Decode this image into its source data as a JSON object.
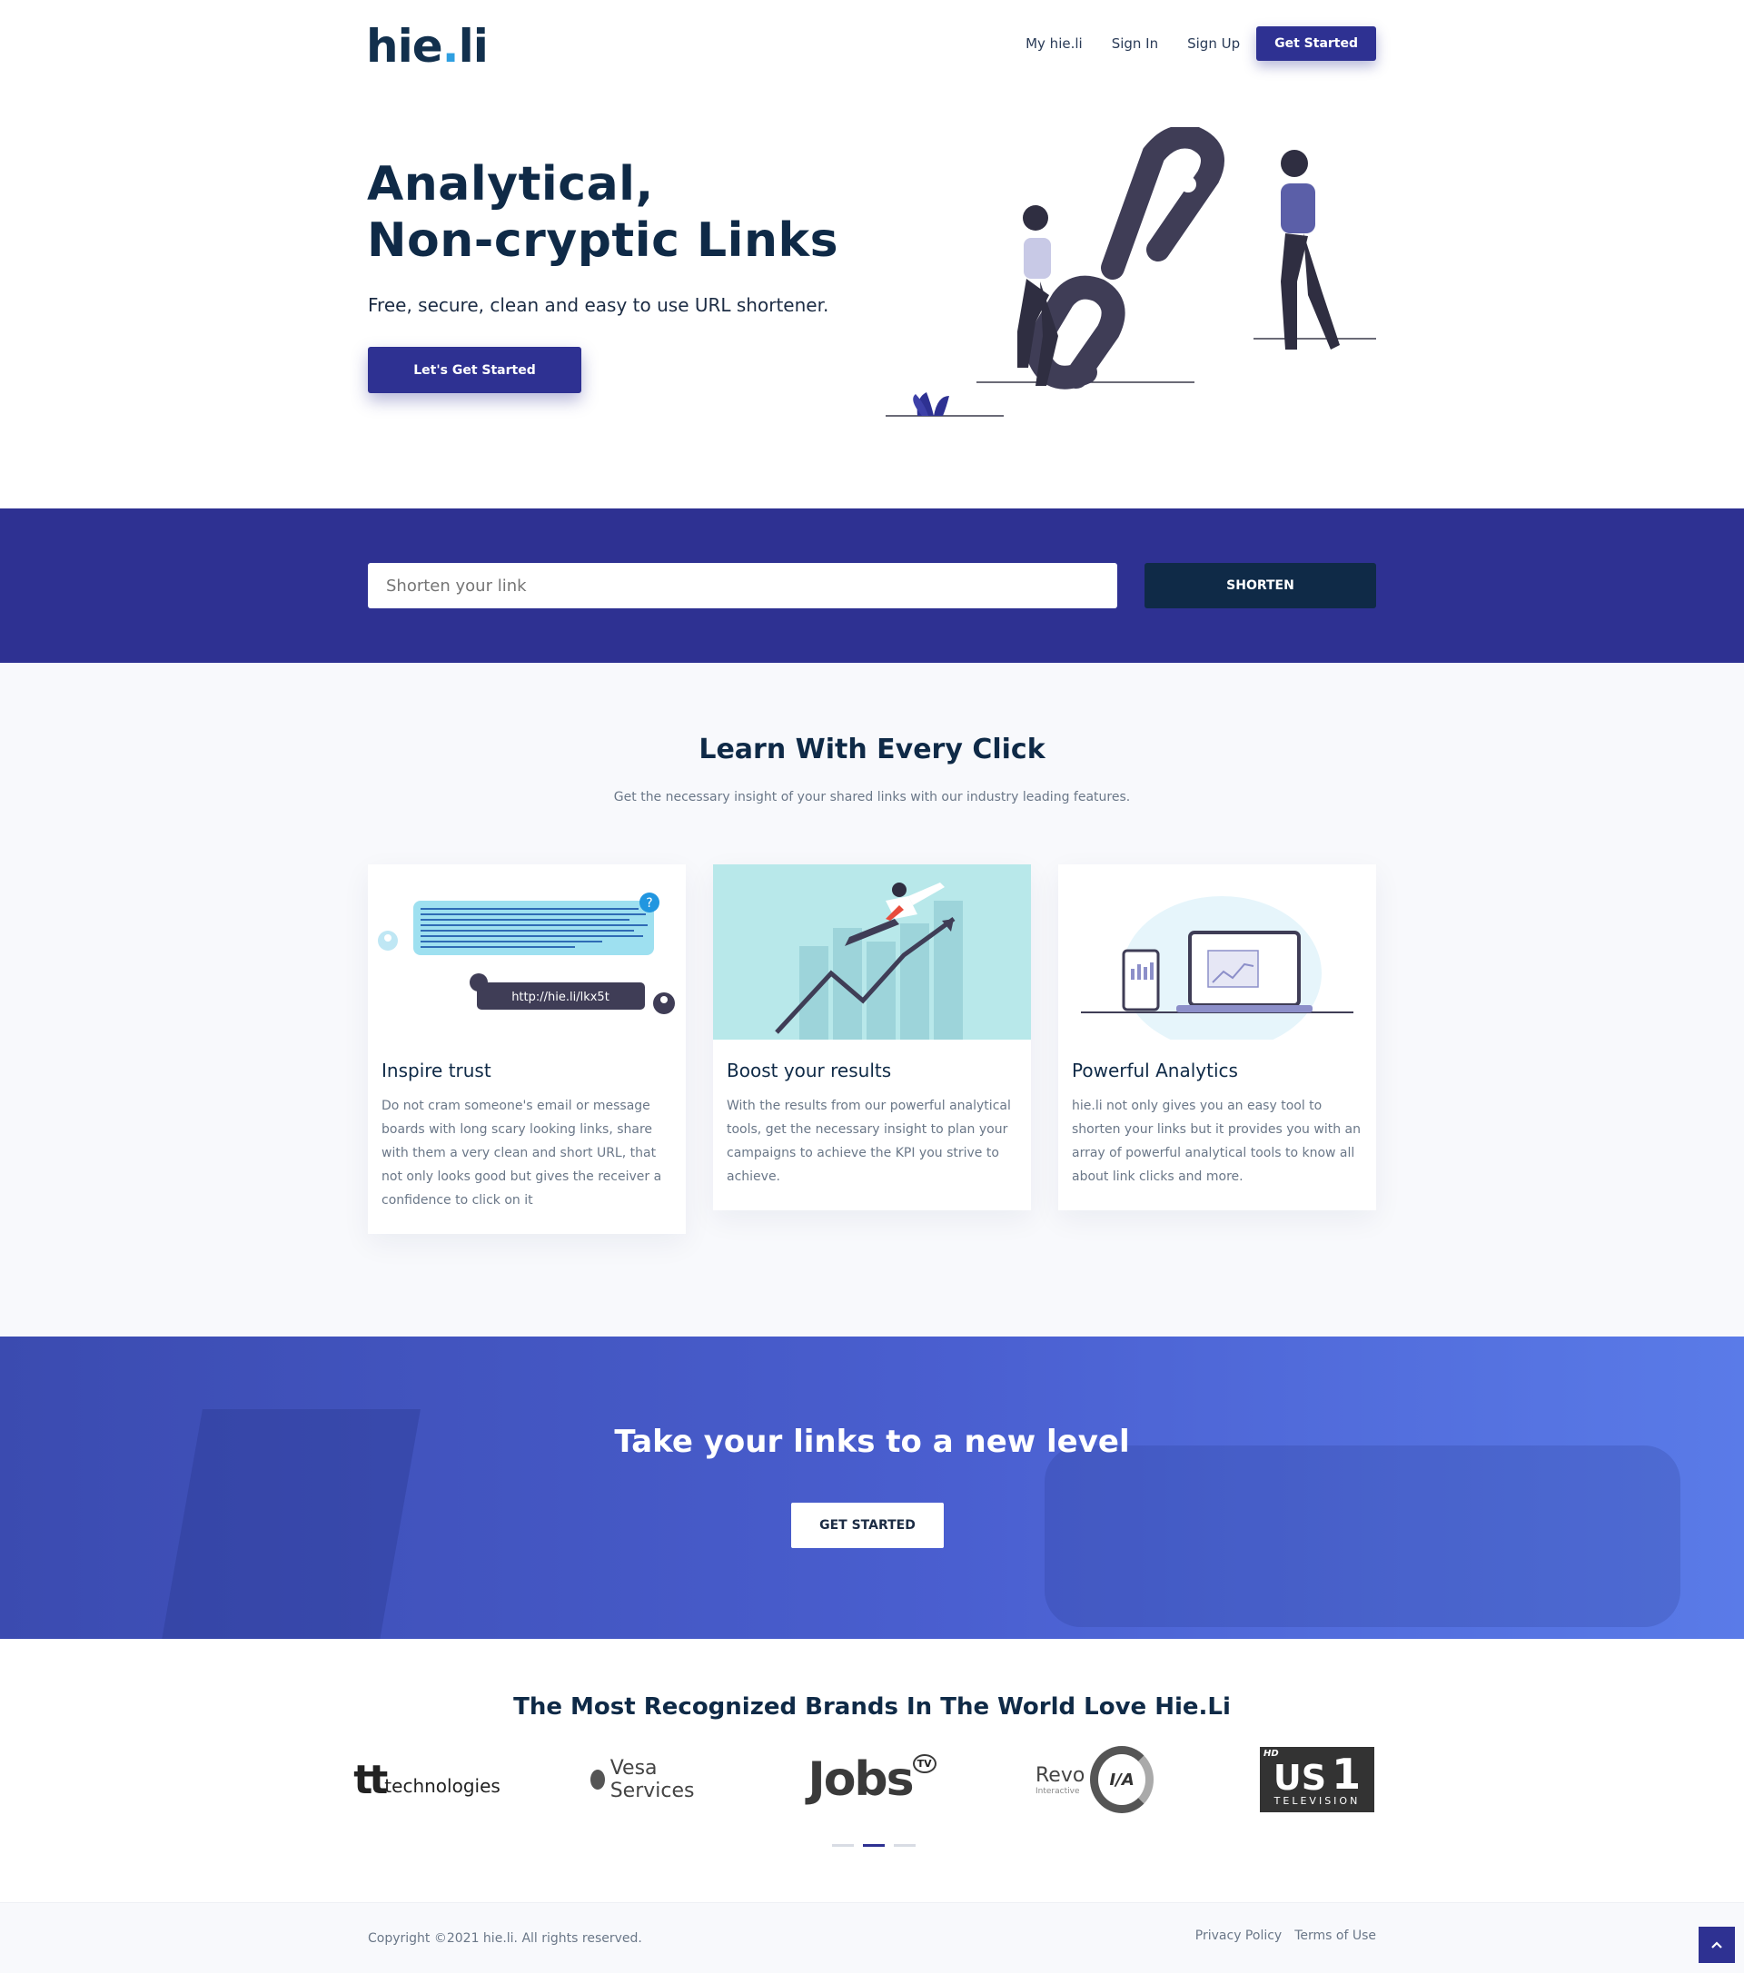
{
  "header": {
    "logo_left": "hie",
    "logo_dot": ".",
    "logo_right": "li",
    "nav": [
      "My hie.li",
      "Sign In",
      "Sign Up"
    ],
    "cta_label": "Get Started"
  },
  "hero": {
    "title_line1": "Analytical,",
    "title_line2": "Non-cryptic Links",
    "subtitle": "Free, secure, clean and easy to use URL shortener.",
    "button_label": "Let's Get Started"
  },
  "shortener": {
    "placeholder": "Shorten your link",
    "button_label": "SHORTEN"
  },
  "features": {
    "title": "Learn With Every Click",
    "subtitle": "Get the necessary insight of your shared links with our industry leading features.",
    "cards": [
      {
        "title": "Inspire trust",
        "text": "Do not cram someone's email or message boards with long scary looking links, share with them a very clean and short URL, that not only looks good but gives the receiver a confidence to click on it",
        "image_short_url": "http://hie.li/lkx5t"
      },
      {
        "title": "Boost your results",
        "text": "With the results from our powerful analytical tools, get the necessary insight to plan your campaigns to achieve the KPI you strive to achieve."
      },
      {
        "title": "Powerful Analytics",
        "text": "hie.li not only gives you an easy tool to shorten your links but it provides you with an array of powerful analytical tools to know all about link clicks and more."
      }
    ]
  },
  "cta": {
    "title": "Take your links to a new level",
    "button_label": "GET STARTED"
  },
  "brands": {
    "title": "The Most Recognized Brands In The World Love Hie.Li",
    "logos": [
      {
        "name": "tt technologies",
        "mark": "tt",
        "text": "technologies"
      },
      {
        "name": "Vesa Services",
        "text": "Vesa Services"
      },
      {
        "name": "Jobs TV",
        "text": "Jobs",
        "sup": "TV"
      },
      {
        "name": "Revo Interactive",
        "text": "Revo",
        "sub": "Interactive",
        "mark": "I/A"
      },
      {
        "name": "US 1 Television",
        "text": "US",
        "num": "1",
        "sub": "TELEVISION",
        "badge": "HD"
      }
    ]
  },
  "footer": {
    "copyright": "Copyright ©2021 hie.li. All rights reserved.",
    "links": [
      "Privacy Policy",
      "Terms of Use"
    ]
  },
  "colors": {
    "primary": "#2e3192",
    "dark": "#0f2a47",
    "muted": "#6a7788",
    "teal_bg": "#b8e8ea",
    "accent": "#2f9fe0"
  },
  "icons": {
    "scroll_top": "chevron-up-icon"
  }
}
